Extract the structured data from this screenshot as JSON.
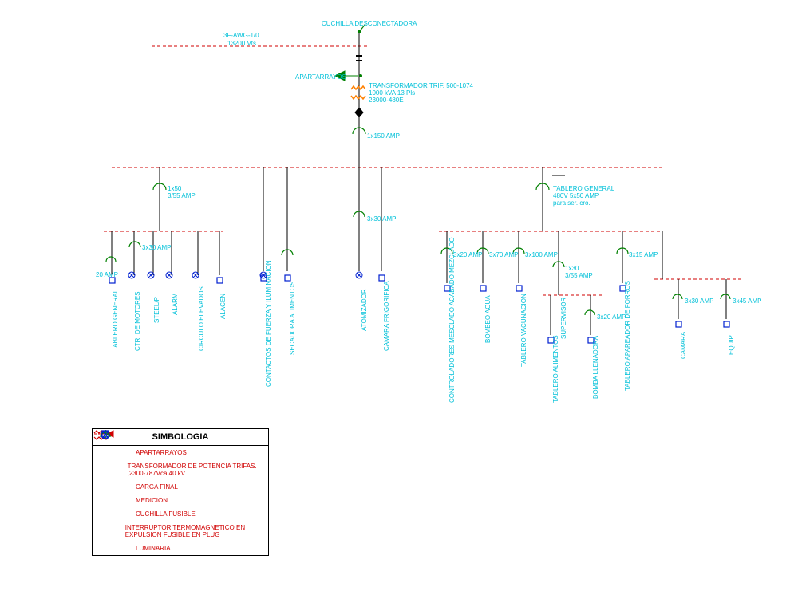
{
  "header": {
    "top_left_1": "3F-AWG-1/0",
    "top_left_2": "13200 Vts",
    "top_right": "CUCHILLA DESCONECTADORA",
    "apart": "APARTARRAYOS",
    "trans_line1": "TRANSFORMADOR TRIF. 500-1074",
    "trans_line2": "1000 kVA 13 Pls",
    "trans_line3": "23000-480E",
    "main_amp": "1x150 AMP"
  },
  "branch1": {
    "top": "1x50\n3/55 AMP",
    "sub": "3x30 AMP",
    "leafs": [
      "20 AMP",
      "",
      "",
      "",
      "",
      ""
    ],
    "names": [
      "TABLERO GENERAL",
      "CTR. DE MOTORES",
      "STEEL/P",
      "ALARM",
      "CIRCULO ELEVADOS",
      "ALACEN"
    ]
  },
  "branch2": {
    "leafs": [
      "",
      ""
    ],
    "names": [
      "CONTACTOS DE FUERZA Y ILUMINACION",
      "SECADORA ALIMENTOS"
    ]
  },
  "branch3": {
    "top": "3x30 AMP",
    "names": [
      "ATOMIZADOR",
      "CAMARA FRIGORIFICA"
    ]
  },
  "branch4": {
    "top": "TABLERO GENERAL\n480V 5x50 AMP\npara ser. cro.",
    "l1": [
      "3x20 AMP",
      "3x70 AMP",
      "3x100 AMP",
      "",
      "3x15 AMP"
    ],
    "l1n": [
      "CONTROLADORES MESCLADO ACABADO MEZCLADO",
      "BOMBEO AGUA",
      "TABLERO VACUNACION",
      "SUPERVISOR",
      "",
      "TABLERO APAREADOR DE FORROS"
    ],
    "mid": "1x30\n3/55 AMP",
    "l2": [
      "",
      "3x20 AMP"
    ],
    "l2n": [
      "TABLERO ALIMENTOS",
      "BOMBA LLENADORA"
    ],
    "r": [
      "3x30 AMP",
      "3x45 AMP"
    ],
    "rn": [
      "CAMARA",
      "EQUIP"
    ]
  },
  "legend": {
    "title": "SIMBOLOGIA",
    "rows": [
      "APARTARRAYOS",
      "TRANSFORMADOR DE POTENCIA TRIFAS. ,2300-787Vca 40 kV",
      "CARGA FINAL",
      "MEDICION",
      "CUCHILLA FUSIBLE",
      "INTERRUPTOR TERMOMAGNETICO EN EXPULSION FUSIBLE EN PLUG",
      "LUMINARIA"
    ]
  },
  "colors": {
    "cyan": "#00c0d8",
    "red": "#d00000",
    "blue": "#0020d0",
    "orange": "#ff8000"
  }
}
